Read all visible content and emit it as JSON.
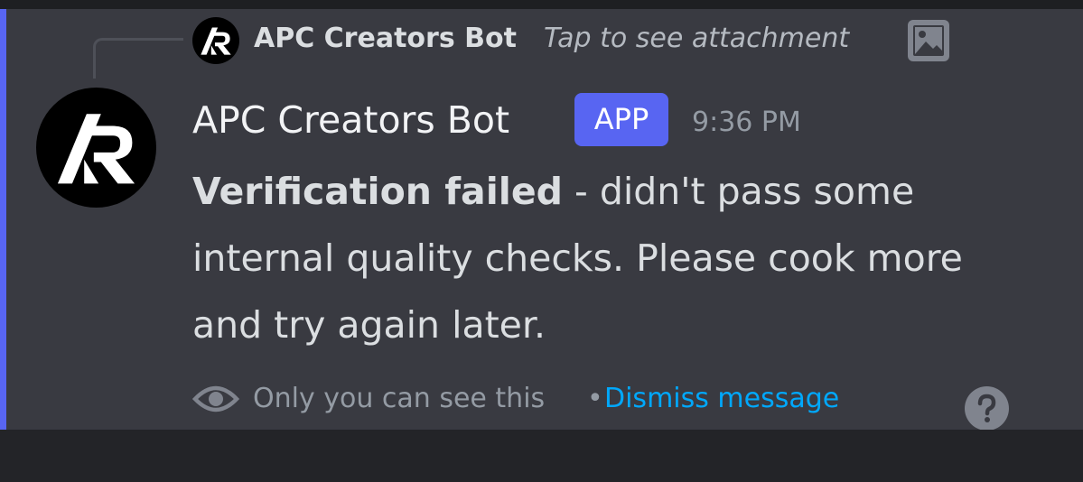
{
  "reply": {
    "author": "APC Creators Bot",
    "preview": "Tap to see attachment"
  },
  "message": {
    "author": "APC Creators Bot",
    "badge": "APP",
    "timestamp": "9:36 PM",
    "content_bold": "Verification failed",
    "content_rest": " - didn't pass some internal quality checks. Please cook more and try again later."
  },
  "ephemeral": {
    "notice": "Only you can see this",
    "separator": "•",
    "dismiss_label": "Dismiss message"
  },
  "icons": {
    "avatar": "apc-logo-avatar",
    "attachment": "image-icon",
    "visibility": "eye-icon",
    "help": "question-icon"
  },
  "colors": {
    "accent": "#5865f2",
    "message_bg": "#393a41",
    "link": "#00a8fc",
    "badge": "#5865f2"
  }
}
